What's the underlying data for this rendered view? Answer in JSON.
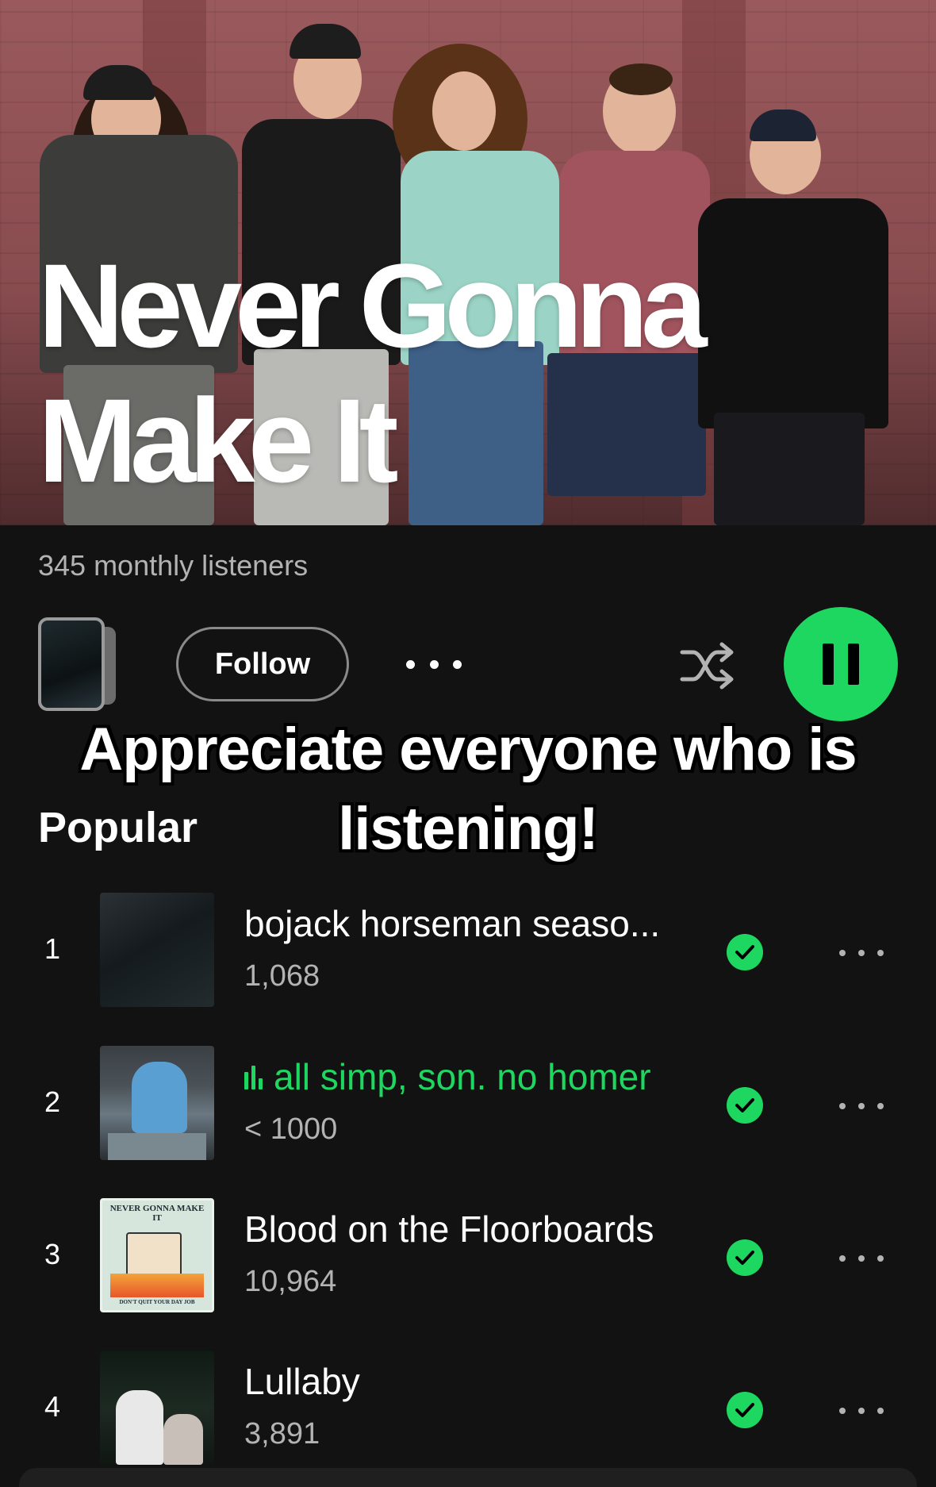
{
  "artist": {
    "name": "Never Gonna Make It",
    "monthly_listeners": "345 monthly listeners"
  },
  "actions": {
    "follow_label": "Follow"
  },
  "overlay_caption": "Appreciate everyone who is listening!",
  "popular": {
    "title": "Popular",
    "tracks": [
      {
        "rank": "1",
        "title": "bojack horseman seaso...",
        "plays": "1,068",
        "playing": false,
        "saved": true
      },
      {
        "rank": "2",
        "title": "all simp, son. no homer",
        "plays": "< 1000",
        "playing": true,
        "saved": true
      },
      {
        "rank": "3",
        "title": "Blood on the Floorboards",
        "plays": "10,964",
        "playing": false,
        "saved": true
      },
      {
        "rank": "4",
        "title": "Lullaby",
        "plays": "3,891",
        "playing": false,
        "saved": true
      }
    ]
  },
  "art_text": {
    "track3_cover_top": "NEVER GONNA MAKE IT",
    "track3_cover_bottom": "DON'T QUIT YOUR DAY JOB"
  },
  "colors": {
    "accent": "#1ed760",
    "background": "#121212",
    "secondary_text": "#b3b3b3"
  },
  "icons": [
    "shuffle-icon",
    "pause-icon",
    "more-icon",
    "check-icon",
    "equalizer-icon"
  ]
}
